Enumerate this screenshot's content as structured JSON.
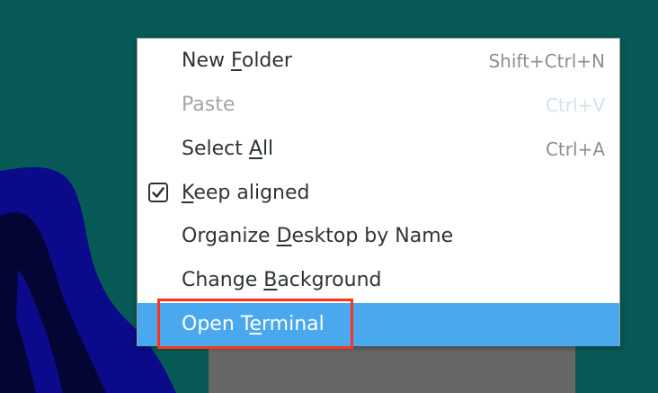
{
  "menu": {
    "items": [
      {
        "pre": "New ",
        "mnemonic": "F",
        "post": "older",
        "accel": "Shift+Ctrl+N",
        "enabled": true
      },
      {
        "pre": "Paste",
        "mnemonic": "",
        "post": "",
        "accel": "Ctrl+V",
        "enabled": false
      },
      {
        "pre": "Select ",
        "mnemonic": "A",
        "post": "ll",
        "accel": "Ctrl+A",
        "enabled": true
      },
      {
        "pre": "",
        "mnemonic": "K",
        "post": "eep aligned",
        "accel": "",
        "enabled": true,
        "checked": true
      },
      {
        "pre": "Organize ",
        "mnemonic": "D",
        "post": "esktop by Name",
        "accel": "",
        "enabled": true
      },
      {
        "pre": "Change ",
        "mnemonic": "B",
        "post": "ackground",
        "accel": "",
        "enabled": true
      },
      {
        "pre": "Open T",
        "mnemonic": "e",
        "post": "rminal",
        "accel": "",
        "enabled": true,
        "highlighted": true
      }
    ]
  },
  "colors": {
    "desktop": "#075a55",
    "highlight": "#4aa8ef",
    "annotation_box": "#ff3318"
  },
  "icons": {
    "check": "checkmark-icon"
  }
}
